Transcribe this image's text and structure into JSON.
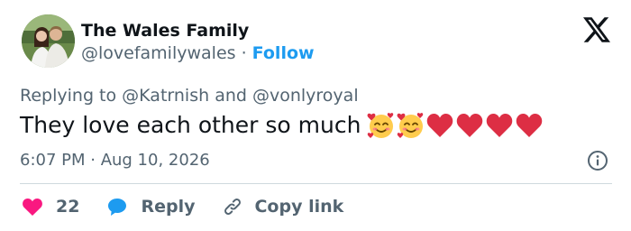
{
  "author": {
    "display_name": "The Wales Family",
    "handle": "@lovefamilywales",
    "separator": "·",
    "follow_label": "Follow"
  },
  "brand": {
    "logo_icon": "x-logo-icon"
  },
  "reply_context": {
    "prefix": "Replying to",
    "mention_1": "@Katrnish",
    "conjunction": "and",
    "mention_2": "@vonlyroyal"
  },
  "tweet": {
    "text": "They love each other so much",
    "emojis": [
      "smiling-face-with-hearts-icon",
      "smiling-face-with-hearts-icon",
      "red-heart-icon",
      "red-heart-icon",
      "red-heart-icon",
      "red-heart-icon"
    ],
    "timestamp": "6:07 PM · Aug 10, 2026"
  },
  "actions": {
    "like_count": "22",
    "reply_label": "Reply",
    "copy_link_label": "Copy link"
  },
  "colors": {
    "accent": "#1d9bf0",
    "like": "#f91880",
    "text": "#0f1419",
    "muted": "#536471",
    "divider": "#cfd9de",
    "heart_emoji": "#e0245e"
  }
}
